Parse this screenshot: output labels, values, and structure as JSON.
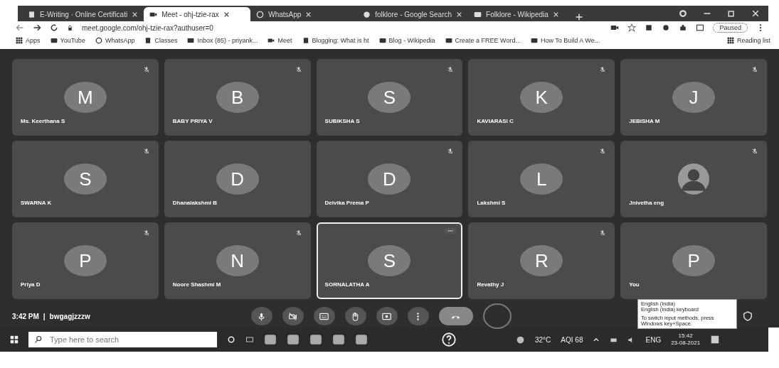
{
  "browser": {
    "tabs": [
      {
        "title": "E-Writing · Online Certificati",
        "selected": false,
        "kind": "doc"
      },
      {
        "title": "Meet - ohj-tzie-rax",
        "selected": true,
        "kind": "meet"
      },
      {
        "title": "WhatsApp",
        "selected": false,
        "kind": "chat"
      },
      {
        "title": "folklore - Google Search",
        "selected": false,
        "kind": "search"
      },
      {
        "title": "Folklore - Wikipedia",
        "selected": false,
        "kind": "wiki"
      }
    ],
    "address": "meet.google.com/ohj-tzie-rax?authuser=0",
    "profile": "Paused",
    "bookmarks": [
      {
        "label": "Apps",
        "kind": "apps"
      },
      {
        "label": "YouTube",
        "kind": "video"
      },
      {
        "label": "WhatsApp",
        "kind": "chat"
      },
      {
        "label": "Classes",
        "kind": "doc"
      },
      {
        "label": "Inbox (85) - priyank...",
        "kind": "mail"
      },
      {
        "label": "Meet",
        "kind": "meet"
      },
      {
        "label": "Blogging: What is ht",
        "kind": "doc"
      },
      {
        "label": "Blog - Wikipedia",
        "kind": "wiki"
      },
      {
        "label": "Create a FREE Word...",
        "kind": "video"
      },
      {
        "label": "How To Build A We...",
        "kind": "video"
      }
    ],
    "reading_list": "Reading list"
  },
  "meet": {
    "tiles": [
      {
        "name": "Ms. Keerthana S",
        "letter": "M",
        "muted": true,
        "selected": false
      },
      {
        "name": "BABY PRIYA V",
        "letter": "B",
        "muted": true,
        "selected": false
      },
      {
        "name": "SUBIKSHA S",
        "letter": "S",
        "muted": true,
        "selected": false
      },
      {
        "name": "KAVIARASI C",
        "letter": "K",
        "muted": true,
        "selected": false
      },
      {
        "name": "JEBISHA M",
        "letter": "J",
        "muted": true,
        "selected": false
      },
      {
        "name": "SWARNA K",
        "letter": "S",
        "muted": true,
        "selected": false
      },
      {
        "name": "Dhanalakshmi B",
        "letter": "D",
        "muted": false,
        "selected": false
      },
      {
        "name": "Deivika Prema P",
        "letter": "D",
        "muted": true,
        "selected": false
      },
      {
        "name": "Lakshmi S",
        "letter": "L",
        "muted": true,
        "selected": false
      },
      {
        "name": "Jnivetha eng",
        "kind": "picture",
        "muted": true,
        "selected": false
      },
      {
        "name": "Priya D",
        "letter": "P",
        "muted": true,
        "selected": false
      },
      {
        "name": "Noore Shashmi M",
        "letter": "N",
        "muted": true,
        "selected": false
      },
      {
        "name": "SORNALATHA A",
        "letter": "S",
        "muted": false,
        "selected": true
      },
      {
        "name": "Revathy J",
        "letter": "R",
        "muted": true,
        "selected": false
      },
      {
        "name": "You",
        "letter": "P",
        "muted": false,
        "selected": false
      }
    ],
    "time": "3:42 PM",
    "separator": "|",
    "meeting_code": "bwgagjzzzw",
    "controls": [
      {
        "kind": "mic"
      },
      {
        "kind": "camera-off"
      },
      {
        "kind": "captions"
      },
      {
        "kind": "hand"
      },
      {
        "kind": "present"
      },
      {
        "kind": "more"
      },
      {
        "kind": "hangup"
      }
    ]
  },
  "tooltip": {
    "lines": [
      "English (India)",
      "English (India) keyboard"
    ],
    "hint": "To switch input methods, press Windows key+Space."
  },
  "taskbar": {
    "search": {
      "placeholder": "Type here to search"
    },
    "temperature": "32°C",
    "aqi": "AQI 68",
    "language": "ENG",
    "time": "15:42",
    "date": "23-08-2021"
  }
}
